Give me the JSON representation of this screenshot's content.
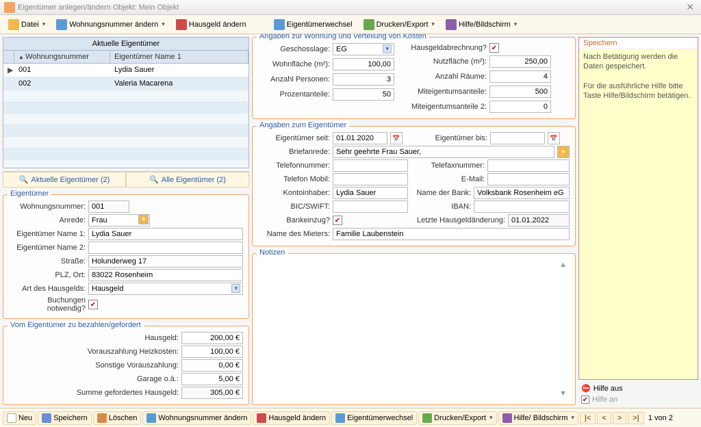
{
  "window": {
    "title": "Eigentümer anlegen/ändern  Objekt: Mein Objekt"
  },
  "toolbar": {
    "datei": "Datei",
    "wohnungsnummer": "Wohnungsnummer ändern",
    "hausgeld": "Hausgeld ändern",
    "wechsel": "Eigentümerwechsel",
    "drucken": "Drucken/Export",
    "hilfe": "Hilfe/Bildschirm"
  },
  "grid": {
    "title": "Aktuelle Eigentümer",
    "col1": "Wohnungsnummer",
    "col2": "Eigentümer Name 1",
    "rows": [
      {
        "marker": "▶",
        "num": "001",
        "name": "Lydia Sauer"
      },
      {
        "marker": "",
        "num": "002",
        "name": "Valeria Macarena"
      }
    ],
    "tab1": "Aktuelle Eigentümer (2)",
    "tab2": "Alle Eigentümer (2)"
  },
  "owner": {
    "legend": "Eigentümer",
    "lbl_wnum": "Wohnungsnummer:",
    "wnum": "001",
    "lbl_anrede": "Anrede:",
    "anrede": "Frau",
    "lbl_name1": "Eigentümer Name 1:",
    "name1": "Lydia Sauer",
    "lbl_name2": "Eigentümer Name 2:",
    "name2": "",
    "lbl_strasse": "Straße:",
    "strasse": "Holunderweg 17",
    "lbl_plz": "PLZ, Ort:",
    "plz": "83022 Rosenheim",
    "lbl_art": "Art des Hausgelds:",
    "art": "Hausgeld",
    "lbl_buch": "Buchungen notwendig?"
  },
  "pay": {
    "legend": "Vom Eigentümer zu bezahlen/gefordert",
    "lbl_hausgeld": "Hausgeld:",
    "hausgeld": "200,00 €",
    "lbl_heizkosten": "Vorauszahlung Heizkosten:",
    "heizkosten": "100,00 €",
    "lbl_sonst": "Sonstige Vorauszahlung:",
    "sonst": "0,00 €",
    "lbl_garage": "Garage o.ä.:",
    "garage": "5,00 €",
    "lbl_summe": "Summe gefordertes Hausgeld:",
    "summe": "305,00 €"
  },
  "wohnung": {
    "legend": "Angaben zur Wohnung und Verteilung von Kosten",
    "lbl_lage": "Geschosslage:",
    "lage": "EG",
    "lbl_flaeche": "Wohnfläche (m²):",
    "flaeche": "100,00",
    "lbl_pers": "Anzahl Personen:",
    "pers": "3",
    "lbl_proz": "Prozentanteile:",
    "proz": "50",
    "lbl_abr": "Hausgeldabrechnung?",
    "lbl_nutz": "Nutzfläche (m²):",
    "nutz": "250,00",
    "lbl_raum": "Anzahl Räume:",
    "raum": "4",
    "lbl_mea": "Miteigentumsanteile:",
    "mea": "500",
    "lbl_mea2": "Miteigentumsanteile 2:",
    "mea2": "0"
  },
  "eig": {
    "legend": "Angaben zum Eigentümer",
    "lbl_seit": "Eigentümer seit:",
    "seit": "01.01.2020",
    "lbl_bis": "Eigentümer bis:",
    "bis": "",
    "lbl_brief": "Briefanrede:",
    "brief": "Sehr geehrte Frau Sauer,",
    "lbl_tel": "Telefonnummer:",
    "tel": "",
    "lbl_fax": "Telefaxnummer:",
    "fax": "",
    "lbl_mobil": "Telefon Mobil:",
    "mobil": "",
    "lbl_email": "E-Mail:",
    "email": "",
    "lbl_konto": "Kontoinhaber:",
    "konto": "Lydia Sauer",
    "lbl_bank": "Name der Bank:",
    "bank": "Volksbank Rosenheim eG",
    "lbl_bic": "BIC/SWIFT:",
    "bic": "",
    "lbl_iban": "IBAN:",
    "iban": "",
    "lbl_einzug": "Bankeinzug?",
    "lbl_letzte": "Letzte Hausgeldänderung:",
    "letzte": "01.01.2022",
    "lbl_mieter": "Name des Mieters:",
    "mieter": "Familie Laubenstein"
  },
  "notiz": {
    "legend": "Notizen"
  },
  "help": {
    "title": "Speichern",
    "body1": "Nach Betätigung werden die Daten gespeichert.",
    "body2": "Für die ausführliche Hilfe bitte Taste Hilfe/Bildschirm betätigen.",
    "aus": "Hilfe aus",
    "an": "Hilfe an"
  },
  "bottom": {
    "neu": "Neu",
    "speichern": "Speichern",
    "loeschen": "Löschen",
    "wnum": "Wohnungsnummer ändern",
    "hausgeld": "Hausgeld ändern",
    "wechsel": "Eigentümerwechsel",
    "drucken": "Drucken/Export",
    "hilfe": "Hilfe/ Bildschirm",
    "pager": "1 von 2"
  }
}
